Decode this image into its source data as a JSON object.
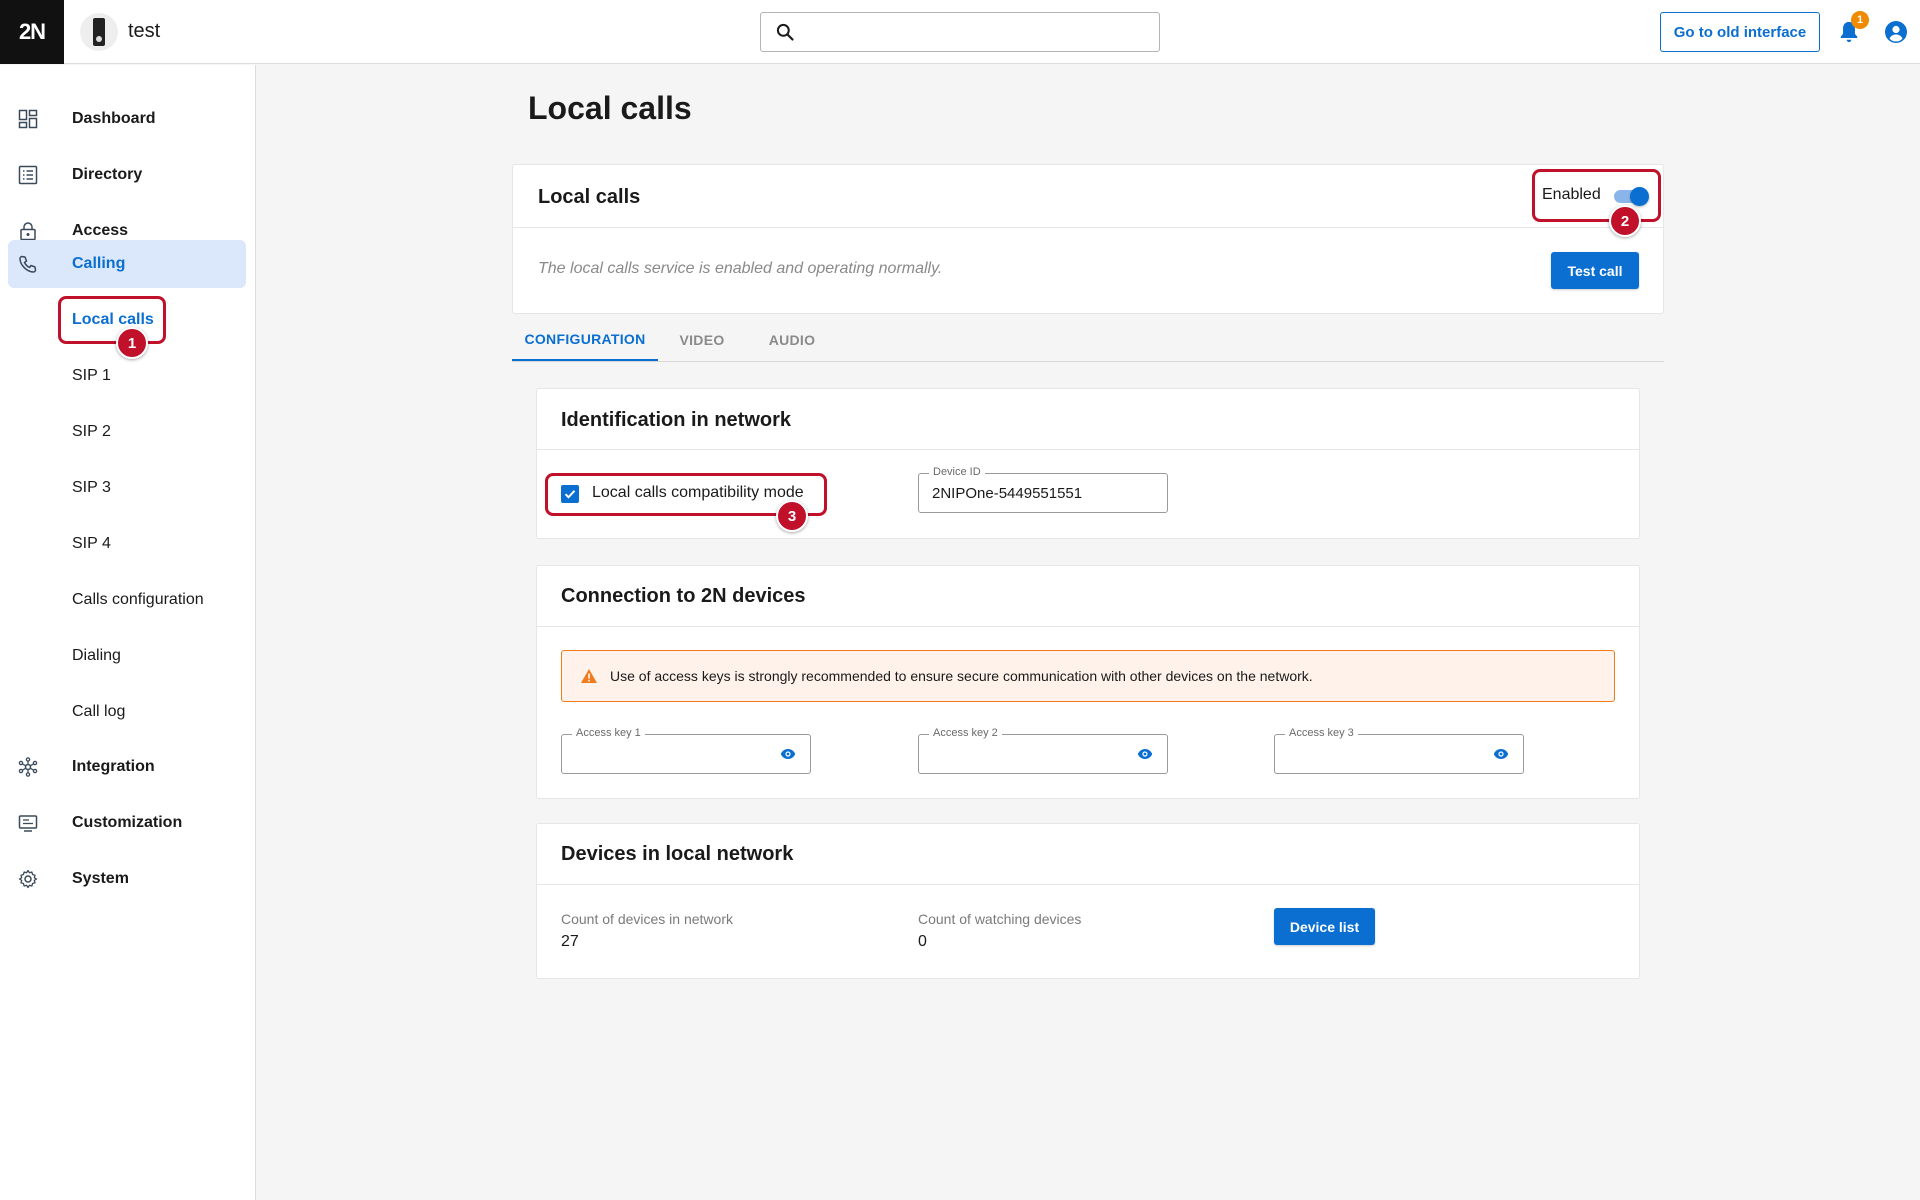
{
  "header": {
    "logo": "2N",
    "device_name": "test",
    "search_placeholder": "",
    "old_interface_label": "Go to old interface",
    "notification_count": "1"
  },
  "sidebar": {
    "items": [
      {
        "label": "Dashboard",
        "icon": "dashboard-icon"
      },
      {
        "label": "Directory",
        "icon": "directory-icon"
      },
      {
        "label": "Access",
        "icon": "lock-icon"
      },
      {
        "label": "Calling",
        "icon": "phone-icon"
      },
      {
        "label": "Integration",
        "icon": "integration-icon"
      },
      {
        "label": "Customization",
        "icon": "customization-icon"
      },
      {
        "label": "System",
        "icon": "gear-icon"
      }
    ],
    "calling_subitems": [
      "Local calls",
      "SIP 1",
      "SIP 2",
      "SIP 3",
      "SIP 4",
      "Calls configuration",
      "Dialing",
      "Call log"
    ]
  },
  "page": {
    "title": "Local calls"
  },
  "service_card": {
    "title": "Local calls",
    "toggle_label": "Enabled",
    "toggle_on": true,
    "status": "The local calls service is enabled and operating normally.",
    "test_call_label": "Test call"
  },
  "tabs": [
    "CONFIGURATION",
    "VIDEO",
    "AUDIO"
  ],
  "identification": {
    "title": "Identification in network",
    "compat_mode_label": "Local calls compatibility mode",
    "compat_mode_checked": true,
    "device_id_label": "Device ID",
    "device_id_value": "2NIPOne-5449551551"
  },
  "connection": {
    "title": "Connection to 2N devices",
    "warning": "Use of access keys is strongly recommended to ensure secure communication with other devices on the network.",
    "keys": [
      "Access key 1",
      "Access key 2",
      "Access key 3"
    ]
  },
  "devices": {
    "title": "Devices in local network",
    "count_label": "Count of devices in network",
    "count_value": "27",
    "watching_label": "Count of watching devices",
    "watching_value": "0",
    "device_list_label": "Device list"
  },
  "annotations": [
    "1",
    "2",
    "3"
  ],
  "colors": {
    "accent": "#0a6fd1",
    "annotation": "#c0102a",
    "warning_border": "#f07c1e",
    "notification": "#f08a00"
  }
}
